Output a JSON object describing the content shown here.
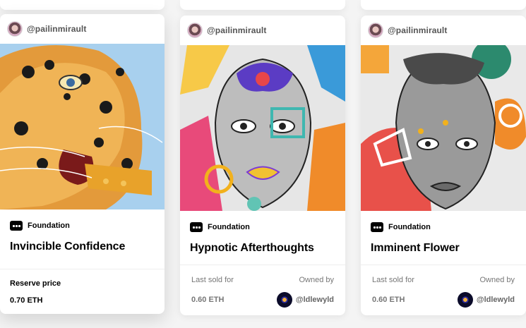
{
  "cards": [
    {
      "creator": "@pailinmirault",
      "platform": "Foundation",
      "title": "Invincible Confidence",
      "price_label": "Reserve price",
      "price": "0.70 ETH"
    },
    {
      "creator": "@pailinmirault",
      "platform": "Foundation",
      "title": "Hypnotic Afterthoughts",
      "price_label": "Last sold for",
      "price": "0.60 ETH",
      "owner_label": "Owned by",
      "owner": "@ldlewyld"
    },
    {
      "creator": "@pailinmirault",
      "platform": "Foundation",
      "title": "Imminent Flower",
      "price_label": "Last sold for",
      "price": "0.60 ETH",
      "owner_label": "Owned by",
      "owner": "@ldlewyld"
    }
  ],
  "colors": {
    "background": "#f4f4f4",
    "card": "#ffffff",
    "text": "#000000",
    "muted": "#777777"
  }
}
